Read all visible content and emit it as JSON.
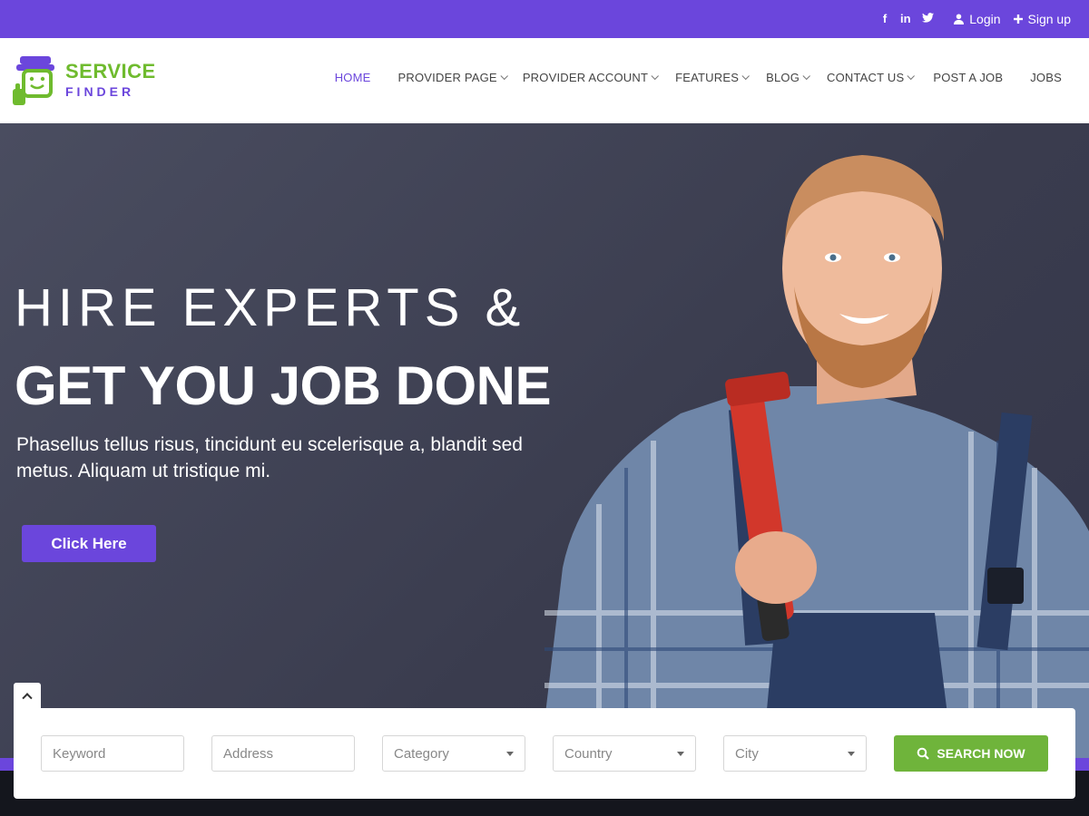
{
  "topbar": {
    "social": [
      {
        "icon": "facebook-icon",
        "glyph": "f"
      },
      {
        "icon": "linkedin-icon",
        "glyph": "in"
      },
      {
        "icon": "twitter-icon",
        "glyph": "t"
      }
    ],
    "login_label": "Login",
    "signup_label": "Sign up"
  },
  "logo": {
    "word1": "SERVICE",
    "word2": "FINDER"
  },
  "nav": {
    "items": [
      {
        "label": "HOME",
        "active": true,
        "dropdown": false
      },
      {
        "label": "PROVIDER PAGE",
        "active": false,
        "dropdown": true
      },
      {
        "label": "PROVIDER ACCOUNT",
        "active": false,
        "dropdown": true
      },
      {
        "label": "FEATURES",
        "active": false,
        "dropdown": true
      },
      {
        "label": "BLOG",
        "active": false,
        "dropdown": true
      },
      {
        "label": "CONTACT US",
        "active": false,
        "dropdown": true
      },
      {
        "label": "POST A JOB",
        "active": false,
        "dropdown": false
      },
      {
        "label": "JOBS",
        "active": false,
        "dropdown": false
      }
    ]
  },
  "hero": {
    "heading_line1": "HIRE EXPERTS &",
    "heading_line2": "GET YOU JOB DONE",
    "description": "Phasellus tellus risus, tincidunt eu scelerisque a, blandit sed metus. Aliquam ut tristique mi.",
    "cta_label": "Click Here"
  },
  "search": {
    "keyword_placeholder": "Keyword",
    "address_placeholder": "Address",
    "category_label": "Category",
    "country_label": "Country",
    "city_label": "City",
    "button_label": "SEARCH NOW"
  },
  "colors": {
    "brand_purple": "#6b46dc",
    "brand_green": "#6fbb2e",
    "button_green": "#6fb43b",
    "hero_bg": "#3f4154"
  }
}
